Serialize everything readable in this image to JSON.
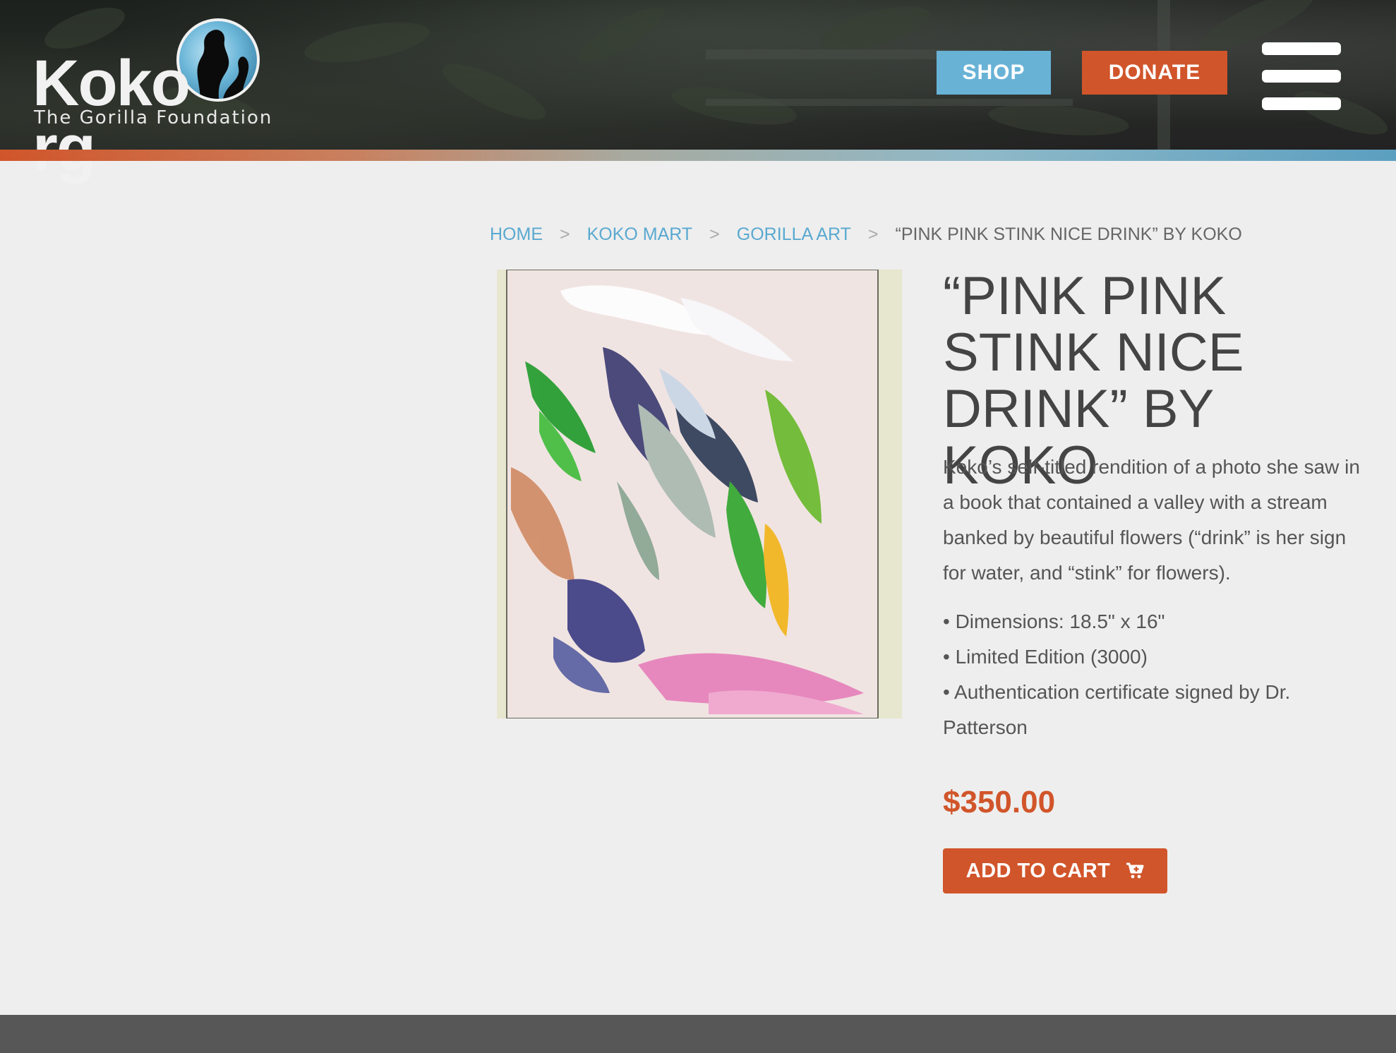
{
  "header": {
    "logo": {
      "word_left": "Koko",
      "word_right": "rg",
      "tagline": "The Gorilla Foundation",
      "icon": "gorilla-globe-icon"
    },
    "shop_label": "SHOP",
    "donate_label": "DONATE",
    "menu_icon": "hamburger-menu-icon"
  },
  "breadcrumb": {
    "items": [
      {
        "label": "HOME"
      },
      {
        "label": "KOKO MART"
      },
      {
        "label": "GORILLA ART"
      }
    ],
    "separator": ">",
    "current": "“PINK PINK STINK NICE DRINK” BY KOKO"
  },
  "product": {
    "title": "“PINK PINK STINK NICE DRINK” BY KOKO",
    "description": "Koko’s self-titled rendition of a photo she saw in a book that contained a valley with a stream banked by beautiful flowers (“drink” is her sign for water, and “stink” for flowers).",
    "features": [
      "• Dimensions: 18.5\" x 16\"",
      "• Limited Edition (3000)",
      "• Authentication certificate signed by Dr. Patterson"
    ],
    "price": "$350.00",
    "add_to_cart_label": "ADD TO CART",
    "cart_icon": "cart-plus-icon"
  },
  "colors": {
    "accent": "#d1552a",
    "link": "#5aa9d0",
    "shop": "#68b2d6",
    "background": "#eeeeee",
    "footer": "#575757"
  }
}
